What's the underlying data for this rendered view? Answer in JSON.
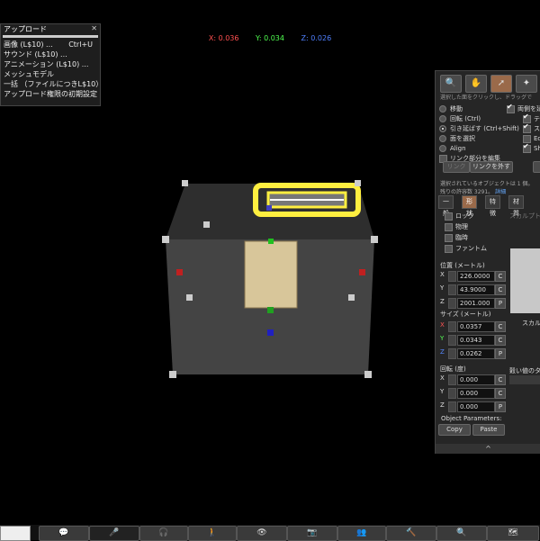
{
  "upload_menu": {
    "title": "アップロード",
    "items": [
      {
        "label": "画像 (L$10) ...",
        "shortcut": "Ctrl+U"
      },
      {
        "label": "サウンド (L$10) ...",
        "shortcut": ""
      },
      {
        "label": "アニメーション (L$10) ...",
        "shortcut": ""
      },
      {
        "label": "メッシュモデル",
        "shortcut": ""
      },
      {
        "label": "一括 （ファイルにつきL$10）",
        "shortcut": ""
      },
      {
        "label": "アップロード権限の初期設定",
        "shortcut": ""
      }
    ]
  },
  "coords": {
    "x": "X: 0.036",
    "y": "Y: 0.034",
    "z": "Z: 0.026"
  },
  "colors": {
    "x": "#ff5050",
    "y": "#50ff50",
    "z": "#5080ff",
    "accent": "#9a6a4a"
  },
  "build_panel": {
    "hint": "選択した面をクリックし、ドラッグで",
    "modes": [
      {
        "label": "移動",
        "selected": false
      },
      {
        "label": "回転 (Ctrl)",
        "selected": false
      },
      {
        "label": "引き延ばす (Ctrl+Shift)",
        "selected": true
      },
      {
        "label": "面を選択",
        "selected": false
      },
      {
        "label": "Align",
        "selected": false
      }
    ],
    "edit_linked": "リンク部分を編集",
    "checks": [
      {
        "label": "両側を延",
        "checked": true
      },
      {
        "label": "テク",
        "checked": true
      },
      {
        "label": "スナ",
        "checked": true
      },
      {
        "label": "Ed",
        "checked": false
      },
      {
        "label": "Sh",
        "checked": true
      }
    ],
    "link_button": "リンク",
    "unlink_button": "リンクを外す",
    "selected_info": "選択されているオブジェクトは 1 個。",
    "remaining": "残りの許容数 3291。",
    "details_link": "詳細",
    "tabs": [
      "一般",
      "形状",
      "特徴",
      "材質"
    ],
    "active_tab": "形状",
    "object_checks": [
      "ロック",
      "物理",
      "臨時",
      "ファントム"
    ],
    "scale_label": "スカルプト",
    "position": {
      "title": "位置 (メートル)",
      "x": "226.0000",
      "y": "43.9000",
      "z": "2001.000"
    },
    "size": {
      "title": "サイズ (メートル)",
      "x": "0.0357",
      "y": "0.0343",
      "z": "0.0262"
    },
    "rotation": {
      "title": "回転 (度)",
      "x": "0.000",
      "y": "0.000",
      "z": "0.000"
    },
    "axis_labels": [
      "X",
      "Y",
      "Z"
    ],
    "c_label": "C",
    "p_label": "P",
    "sculpt_label": "スカル",
    "cut_label": "穀い値のタイ",
    "object_params": "Object Parameters:",
    "copy_button": "Copy",
    "paste_button": "Paste",
    "collapse_icon": "^"
  },
  "toolbar": {
    "buttons": [
      {
        "name": "chat-button",
        "glyph": "💬",
        "dim": false
      },
      {
        "name": "voice-button",
        "glyph": "🎤",
        "dim": true
      },
      {
        "name": "speak-button",
        "glyph": "🎧",
        "dim": false
      },
      {
        "name": "walk-button",
        "glyph": "🚶",
        "dim": false
      },
      {
        "name": "view-button",
        "glyph": "👁",
        "dim": false
      },
      {
        "name": "snapshot-button",
        "glyph": "📷",
        "dim": false
      },
      {
        "name": "people-button",
        "glyph": "👥",
        "dim": false
      },
      {
        "name": "build-button",
        "glyph": "🔨",
        "dim": false
      },
      {
        "name": "search-button",
        "glyph": "🔍",
        "dim": false
      },
      {
        "name": "map-button",
        "glyph": "🗺",
        "dim": false
      }
    ]
  }
}
